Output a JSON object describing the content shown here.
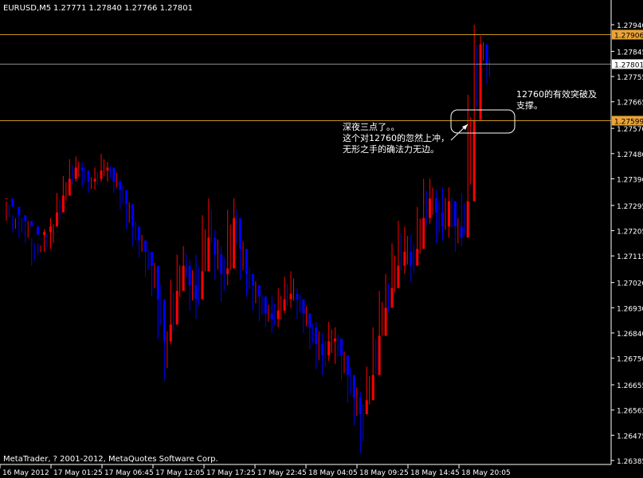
{
  "header": {
    "symbol_line": "EURUSD,M5",
    "ohlc_line": "1.27771 1.27840 1.27766 1.27801"
  },
  "footer": {
    "copyright": "MetaTrader, ? 2001-2012, MetaQuotes Software Corp."
  },
  "annotations": {
    "left_lines": [
      "深夜三点了。。",
      "这个对12760的忽然上冲，",
      "无形之手的确法力无边。"
    ],
    "right_lines": [
      "12760的有效突破及",
      "支撑。"
    ]
  },
  "colors": {
    "background": "#000000",
    "bull": "#ff0000",
    "bear": "#0000ff",
    "grid_text": "#ffffff",
    "hline_orange": "#c8961e",
    "hline_gray": "#8c8c8c",
    "price_badge_orange": "#e8a33a",
    "price_badge_current": "#ffffff",
    "annotation_box": "#ffffff"
  },
  "chart_data": {
    "type": "candlestick",
    "symbol": "EURUSD",
    "timeframe": "M5",
    "y_ticks": [
      1.2794,
      1.27845,
      1.27755,
      1.27665,
      1.2757,
      1.2748,
      1.2739,
      1.27295,
      1.27205,
      1.27115,
      1.2702,
      1.2693,
      1.2684,
      1.2675,
      1.26655,
      1.26565,
      1.26475,
      1.26385
    ],
    "y_tick_labels": [
      "1.27940",
      "1.27845",
      "1.27755",
      "1.27665",
      "1.27570",
      "1.27480",
      "1.27390",
      "1.27295",
      "1.27205",
      "1.27115",
      "1.27020",
      "1.26930",
      "1.26840",
      "1.26750",
      "1.26655",
      "1.26565",
      "1.26475",
      "1.26385"
    ],
    "ylim": [
      1.2633,
      1.2797
    ],
    "x_labels": [
      "16 May 2012",
      "17 May 01:25",
      "17 May 06:45",
      "17 May 12:05",
      "17 May 17:25",
      "17 May 22:45",
      "18 May 04:05",
      "18 May 09:25",
      "18 May 14:45",
      "18 May 20:05"
    ],
    "hlines": [
      {
        "value": 1.27906,
        "label": "1.27906",
        "style": "orange"
      },
      {
        "value": 1.27801,
        "label": "1.27801",
        "style": "current"
      },
      {
        "value": 1.27599,
        "label": "1.27599",
        "style": "orange"
      }
    ],
    "candles": [
      [
        1.2732,
        1.2731,
        1.2724
      ],
      [
        1.2729,
        1.2726,
        1.272
      ],
      [
        1.2726,
        1.2727,
        1.2718
      ],
      [
        1.2724,
        1.2726,
        1.2716
      ],
      [
        1.2722,
        1.2718,
        1.2708
      ],
      [
        1.2719,
        1.2716,
        1.2712
      ],
      [
        1.272,
        1.2721,
        1.2713
      ],
      [
        1.2722,
        1.2725,
        1.2714
      ],
      [
        1.2727,
        1.2734,
        1.2722
      ],
      [
        1.2733,
        1.274,
        1.2729
      ],
      [
        1.2739,
        1.2746,
        1.2735
      ],
      [
        1.2743,
        1.2747,
        1.2738
      ],
      [
        1.2742,
        1.2745,
        1.2736
      ],
      [
        1.2738,
        1.2741,
        1.2734
      ],
      [
        1.2739,
        1.2743,
        1.2735
      ],
      [
        1.2742,
        1.2748,
        1.2738
      ],
      [
        1.2743,
        1.2745,
        1.2738
      ],
      [
        1.2738,
        1.2743,
        1.2734
      ],
      [
        1.2735,
        1.2739,
        1.2728
      ],
      [
        1.273,
        1.2733,
        1.2721
      ],
      [
        1.2722,
        1.2726,
        1.2715
      ],
      [
        1.2717,
        1.2721,
        1.2711
      ],
      [
        1.2713,
        1.2716,
        1.2704
      ],
      [
        1.2708,
        1.2712,
        1.2697
      ],
      [
        1.2696,
        1.2706,
        1.2682
      ],
      [
        1.2681,
        1.2689,
        1.2667
      ],
      [
        1.2687,
        1.2703,
        1.268
      ],
      [
        1.2699,
        1.2712,
        1.2693
      ],
      [
        1.2708,
        1.2715,
        1.2701
      ],
      [
        1.2701,
        1.271,
        1.2692
      ],
      [
        1.2696,
        1.2712,
        1.2689
      ],
      [
        1.2706,
        1.2726,
        1.2701
      ],
      [
        1.2718,
        1.2732,
        1.2712
      ],
      [
        1.2712,
        1.2721,
        1.2703
      ],
      [
        1.2705,
        1.2715,
        1.2695
      ],
      [
        1.2707,
        1.2728,
        1.2701
      ],
      [
        1.2725,
        1.2732,
        1.2712
      ],
      [
        1.2714,
        1.272,
        1.2703
      ],
      [
        1.2705,
        1.271,
        1.2697
      ],
      [
        1.2701,
        1.2705,
        1.2692
      ],
      [
        1.2697,
        1.27,
        1.2688
      ],
      [
        1.2691,
        1.2696,
        1.2686
      ],
      [
        1.2689,
        1.2697,
        1.2684
      ],
      [
        1.2692,
        1.27,
        1.2686
      ],
      [
        1.2696,
        1.2704,
        1.2691
      ],
      [
        1.2698,
        1.2706,
        1.2693
      ],
      [
        1.2696,
        1.27,
        1.2689
      ],
      [
        1.2691,
        1.2696,
        1.2684
      ],
      [
        1.2686,
        1.269,
        1.2678
      ],
      [
        1.268,
        1.2688,
        1.2671
      ],
      [
        1.2676,
        1.2684,
        1.2669
      ],
      [
        1.2681,
        1.2688,
        1.2674
      ],
      [
        1.2682,
        1.2686,
        1.2673
      ],
      [
        1.2676,
        1.268,
        1.2667
      ],
      [
        1.2669,
        1.2675,
        1.2659
      ],
      [
        1.2661,
        1.2668,
        1.2651
      ],
      [
        1.2655,
        1.2663,
        1.2641
      ],
      [
        1.266,
        1.2672,
        1.2655
      ],
      [
        1.2669,
        1.2686,
        1.2665
      ],
      [
        1.2683,
        1.2699,
        1.2679
      ],
      [
        1.2693,
        1.2705,
        1.2688
      ],
      [
        1.27,
        1.2716,
        1.2694
      ],
      [
        1.2708,
        1.2724,
        1.2702
      ],
      [
        1.2713,
        1.2722,
        1.2705
      ],
      [
        1.2708,
        1.2719,
        1.2702
      ],
      [
        1.2714,
        1.2729,
        1.2708
      ],
      [
        1.2725,
        1.2739,
        1.2718
      ],
      [
        1.2732,
        1.2739,
        1.2723
      ],
      [
        1.2727,
        1.2735,
        1.2716
      ],
      [
        1.2722,
        1.2736,
        1.2717
      ],
      [
        1.2731,
        1.2736,
        1.2718
      ],
      [
        1.2722,
        1.2728,
        1.2713
      ],
      [
        1.2718,
        1.2734,
        1.2715
      ],
      [
        1.2731,
        1.2769,
        1.2729
      ],
      [
        1.276,
        1.2794,
        1.2757
      ],
      [
        1.2787,
        1.279,
        1.2779
      ],
      [
        1.278,
        1.2784,
        1.2773
      ]
    ]
  }
}
